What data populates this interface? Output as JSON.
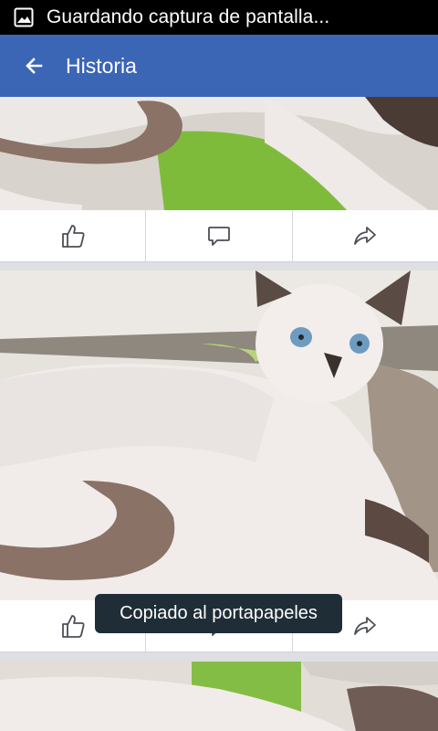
{
  "status_bar": {
    "notification_icon": "image-icon",
    "notification_text": "Guardando captura de pantalla..."
  },
  "app_bar": {
    "back_icon": "arrow-left-icon",
    "title": "Historia"
  },
  "posts": [
    {
      "photo": "siamese-kitten-photo",
      "actions": [
        "like-icon",
        "comment-icon",
        "share-icon"
      ]
    },
    {
      "photo": "siamese-kitten-photo",
      "actions": [
        "like-icon",
        "comment-icon",
        "share-icon"
      ]
    },
    {
      "photo": "siamese-kitten-photo"
    }
  ],
  "toast": {
    "text": "Copiado al portapapeles"
  },
  "colors": {
    "status_bar": "#000000",
    "app_bar": "#3b65b5",
    "feed_background": "#dddfe2",
    "toast_background": "#1f2d36"
  }
}
